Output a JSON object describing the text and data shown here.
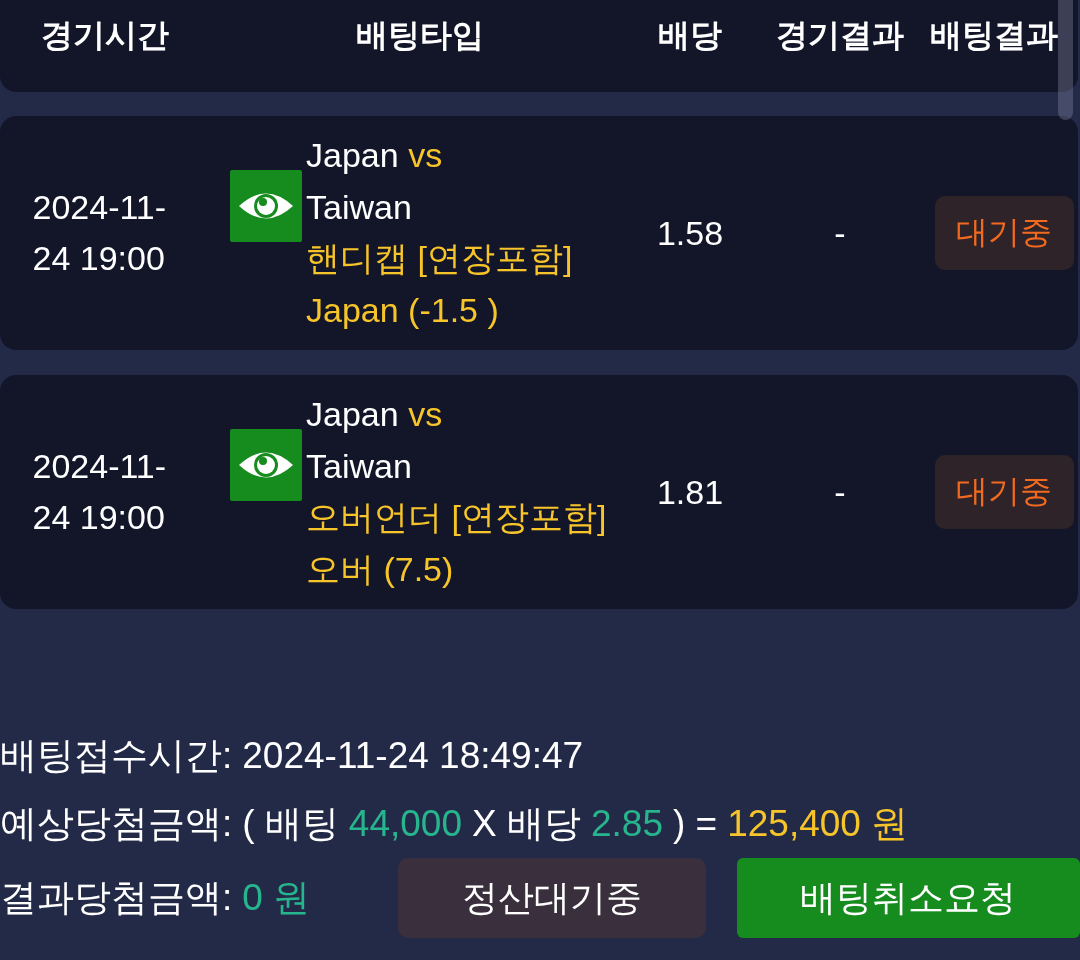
{
  "table": {
    "columns": [
      "경기시간",
      "배팅타입",
      "배당",
      "경기결과",
      "배팅결과"
    ],
    "rows": [
      {
        "time": "2024-11-24 19:00",
        "home": "Japan",
        "vs": "vs",
        "away": "Taiwan",
        "market": "핸디캡 [연장포함]",
        "pick": "Japan (-1.5 )",
        "odds": "1.58",
        "score": "-",
        "result": {
          "label": "대기중",
          "kind": "pending"
        }
      },
      {
        "time": "2024-11-24 19:00",
        "home": "Japan",
        "vs": "vs",
        "away": "Taiwan",
        "market": "오버언더 [연장포함]",
        "pick": "오버 (7.5)",
        "odds": "1.81",
        "score": "-",
        "result": {
          "label": "대기중",
          "kind": "pending"
        }
      }
    ]
  },
  "summary": {
    "bet_time": {
      "label": "배팅접수시간:",
      "value": "2024-11-24 18:49:47"
    },
    "expected_win": {
      "label": "예상당첨금액:",
      "open": "( 배팅",
      "stake": "44,000",
      "times": "X 배당",
      "odds": "2.85",
      "close": ") =",
      "payout": "125,400 원"
    },
    "actual_win": {
      "label": "결과당첨금액:",
      "value": "0 원"
    },
    "buttons": [
      {
        "label": "정산대기중",
        "kind": "status"
      },
      {
        "label": "배팅취소요청",
        "kind": "action"
      }
    ]
  }
}
